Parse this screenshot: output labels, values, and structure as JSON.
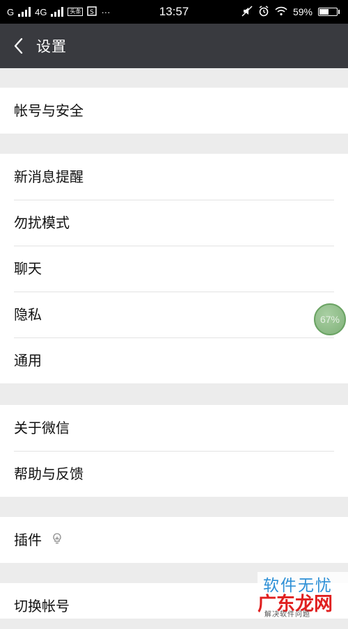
{
  "status_bar": {
    "carrier_1": "G",
    "network_2": "4G",
    "app_badge": "头条",
    "more": "···",
    "time": "13:57",
    "battery_percent": "59%",
    "battery_level": 0.59,
    "icons": [
      "signal-icon",
      "notification-icon",
      "mute-icon",
      "alarm-icon",
      "wifi-icon",
      "battery-icon"
    ]
  },
  "header": {
    "title": "设置"
  },
  "groups": [
    {
      "items": [
        {
          "label": "帐号与安全"
        }
      ]
    },
    {
      "items": [
        {
          "label": "新消息提醒"
        },
        {
          "label": "勿扰模式"
        },
        {
          "label": "聊天"
        },
        {
          "label": "隐私"
        },
        {
          "label": "通用"
        }
      ]
    },
    {
      "items": [
        {
          "label": "关于微信"
        },
        {
          "label": "帮助与反馈"
        }
      ]
    },
    {
      "items": [
        {
          "label": "插件"
        }
      ]
    },
    {
      "items": [
        {
          "label": "切换帐号"
        }
      ]
    }
  ],
  "float_ball": {
    "value": "67%"
  },
  "watermark": {
    "top": "软件无忧",
    "main": "广东龙网",
    "sub": "解决软件问题"
  },
  "colors": {
    "header_bg": "#393a3f",
    "page_bg": "#ececec",
    "item_bg": "#ffffff"
  }
}
